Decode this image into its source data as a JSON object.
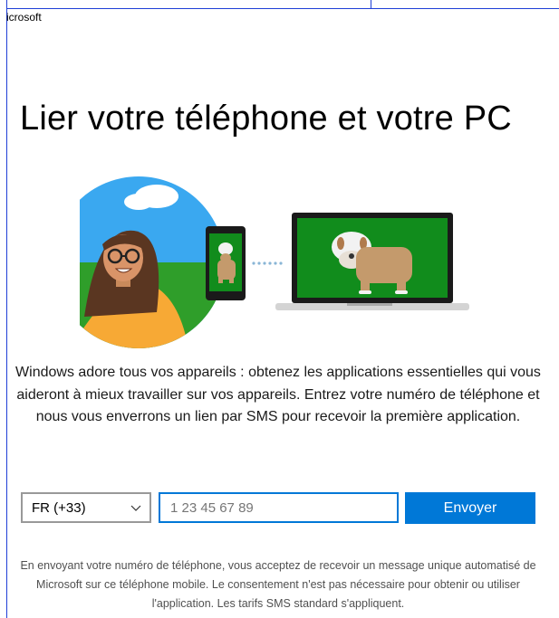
{
  "window": {
    "brand_text": "icrosoft"
  },
  "page": {
    "title": "Lier votre téléphone et votre PC",
    "description": "Windows adore tous vos appareils : obtenez les applications essentielles qui vous aideront à mieux travailler sur vos appareils. Entrez votre numéro de téléphone et nous vous enverrons un lien par SMS pour recevoir la première application."
  },
  "form": {
    "country_code": "FR (+33)",
    "phone_placeholder": "1 23 45 67 89",
    "phone_value": "",
    "send_label": "Envoyer"
  },
  "disclaimer": "En envoyant votre numéro de téléphone, vous acceptez de recevoir un message unique automatisé de Microsoft sur ce téléphone mobile. Le consentement n'est pas nécessaire pour obtenir ou utiliser l'application. Les tarifs SMS standard s'appliquent.",
  "icons": {
    "illustration": "person-phone-laptop-dog-illustration",
    "dropdown": "chevron-down-icon"
  },
  "colors": {
    "accent": "#0078d7",
    "frame": "#1f3fd6",
    "screen_green": "#118c1c",
    "sky": "#3aa8f0"
  }
}
